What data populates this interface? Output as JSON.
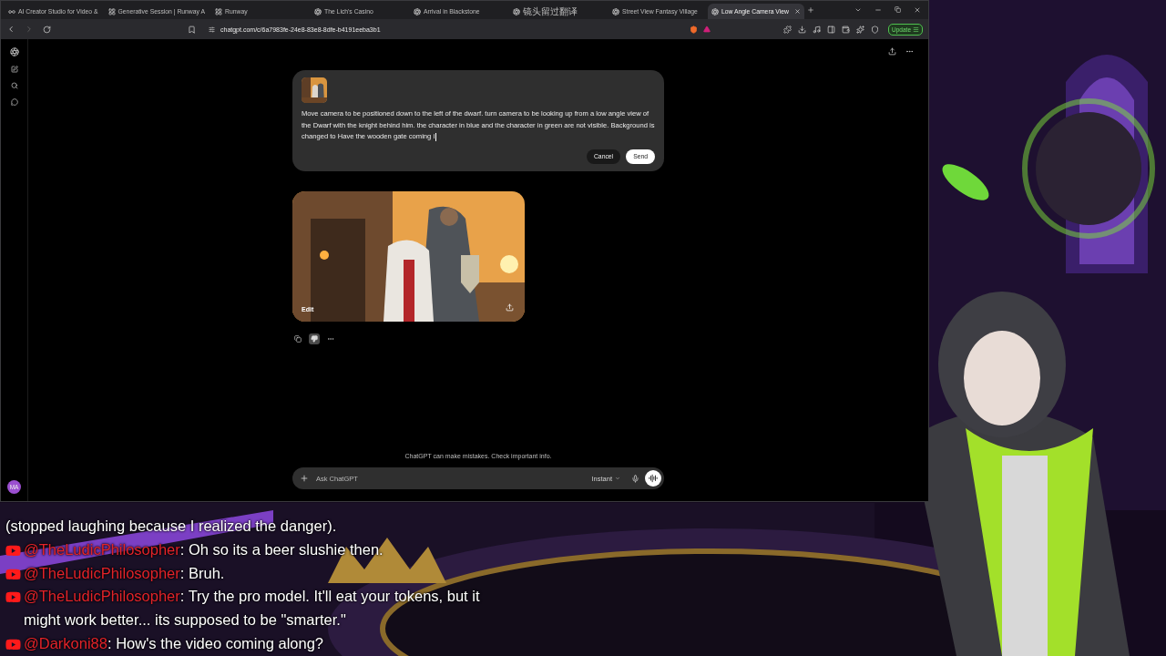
{
  "browser": {
    "tabs": [
      {
        "title": "AI Creator Studio for Video &",
        "kind": "infinity",
        "selected": false
      },
      {
        "title": "Generative Session | Runway A",
        "kind": "runway",
        "selected": false
      },
      {
        "title": "Runway",
        "kind": "runway",
        "selected": false
      },
      {
        "title": "The Lich's Casino",
        "kind": "gpt",
        "selected": false
      },
      {
        "title": "Arrival in Blackstone",
        "kind": "gpt",
        "selected": false
      },
      {
        "title": "镜头留过翻译",
        "kind": "gpt",
        "selected": false
      },
      {
        "title": "Street View Fantasy Village",
        "kind": "gpt",
        "selected": false
      },
      {
        "title": "Low Angle Camera View",
        "kind": "gpt",
        "selected": true
      }
    ],
    "url": "chatgpt.com/c/6a7983fe-24e8-83e8-8dfe-b4191eeba3b1",
    "update_button": "Update"
  },
  "sidebar": {
    "avatar": "MA"
  },
  "prompt_editor": {
    "text": "Move camera to be positioned down to the left of the dwarf. turn camera to be looking up from a low angle view of the Dwarf with the knight behind him. the character in blue and the character in green are not visible. Background is changed to Have the wooden gate coming i",
    "cancel_button": "Cancel",
    "send_button": "Send"
  },
  "image_card": {
    "edit_button": "Edit"
  },
  "response": {
    "disliked": true
  },
  "disclaimer": "ChatGPT can make mistakes. Check important info.",
  "composer": {
    "placeholder": "Ask ChatGPT",
    "model": "Instant"
  },
  "stream_chat": [
    {
      "kind": "continuation",
      "text": "(stopped laughing because I realized the danger)."
    },
    {
      "kind": "message",
      "author": "@TheLudicPhilosopher",
      "text": ": Oh so its a beer slushie then."
    },
    {
      "kind": "message",
      "author": "@TheLudicPhilosopher",
      "text": ": Bruh."
    },
    {
      "kind": "message",
      "author": "@TheLudicPhilosopher",
      "text": ": Try the pro model. It'll eat your tokens, but it might work better... its supposed to be \"smarter.\""
    },
    {
      "kind": "message",
      "author": "@Darkoni88",
      "text": ": How's the video coming along?"
    }
  ]
}
